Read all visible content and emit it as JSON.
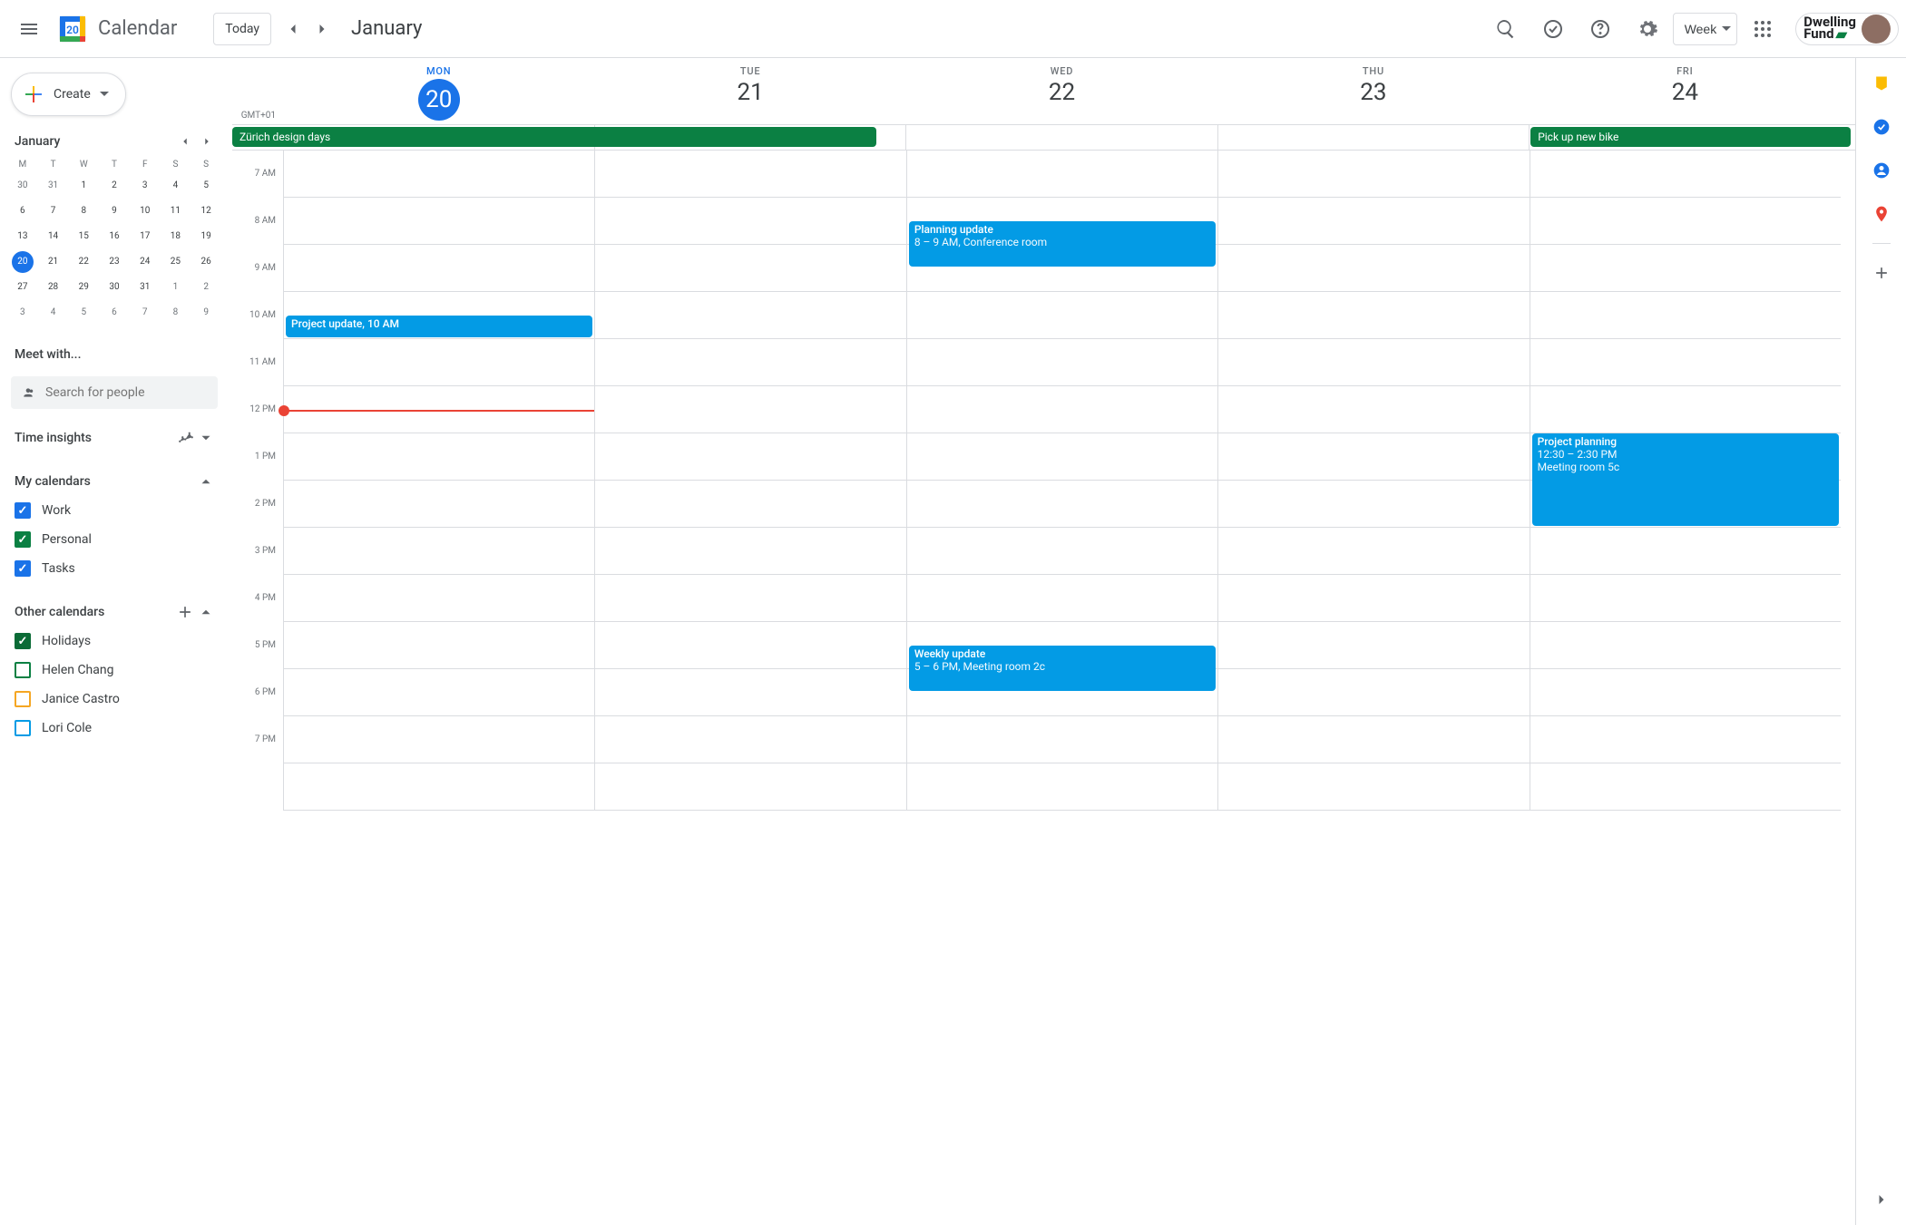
{
  "header": {
    "app_name": "Calendar",
    "today_btn": "Today",
    "period": "January",
    "view_label": "Week",
    "org_name_line1": "Dwelling",
    "org_name_line2": "Fund"
  },
  "sidebar": {
    "create_label": "Create",
    "mini_month": "January",
    "dow": [
      "M",
      "T",
      "W",
      "T",
      "F",
      "S",
      "S"
    ],
    "weeks": [
      [
        {
          "d": "30",
          "o": true
        },
        {
          "d": "31",
          "o": true
        },
        {
          "d": "1"
        },
        {
          "d": "2"
        },
        {
          "d": "3"
        },
        {
          "d": "4"
        },
        {
          "d": "5"
        }
      ],
      [
        {
          "d": "6"
        },
        {
          "d": "7"
        },
        {
          "d": "8"
        },
        {
          "d": "9"
        },
        {
          "d": "10"
        },
        {
          "d": "11"
        },
        {
          "d": "12"
        }
      ],
      [
        {
          "d": "13"
        },
        {
          "d": "14"
        },
        {
          "d": "15"
        },
        {
          "d": "16"
        },
        {
          "d": "17"
        },
        {
          "d": "18"
        },
        {
          "d": "19"
        }
      ],
      [
        {
          "d": "20",
          "t": true
        },
        {
          "d": "21"
        },
        {
          "d": "22"
        },
        {
          "d": "23"
        },
        {
          "d": "24"
        },
        {
          "d": "25"
        },
        {
          "d": "26"
        }
      ],
      [
        {
          "d": "27"
        },
        {
          "d": "28"
        },
        {
          "d": "29"
        },
        {
          "d": "30"
        },
        {
          "d": "31"
        },
        {
          "d": "1",
          "o": true
        },
        {
          "d": "2",
          "o": true
        }
      ],
      [
        {
          "d": "3",
          "o": true
        },
        {
          "d": "4",
          "o": true
        },
        {
          "d": "5",
          "o": true
        },
        {
          "d": "6",
          "o": true
        },
        {
          "d": "7",
          "o": true
        },
        {
          "d": "8",
          "o": true
        },
        {
          "d": "9",
          "o": true
        }
      ]
    ],
    "meet_with": "Meet with...",
    "search_placeholder": "Search for people",
    "time_insights": "Time insights",
    "my_calendars": "My calendars",
    "other_calendars": "Other calendars",
    "my_cals": [
      {
        "label": "Work",
        "color": "#1a73e8",
        "checked": true
      },
      {
        "label": "Personal",
        "color": "#0b8043",
        "checked": true
      },
      {
        "label": "Tasks",
        "color": "#1a73e8",
        "checked": true
      }
    ],
    "other_cals": [
      {
        "label": "Holidays",
        "color": "#0b6b36",
        "checked": true
      },
      {
        "label": "Helen Chang",
        "color": "#0b8043",
        "checked": false
      },
      {
        "label": "Janice Castro",
        "color": "#f5a623",
        "checked": false
      },
      {
        "label": "Lori Cole",
        "color": "#039be5",
        "checked": false
      }
    ]
  },
  "week": {
    "tz": "GMT+01",
    "days": [
      {
        "dow": "MON",
        "num": "20",
        "today": true
      },
      {
        "dow": "TUE",
        "num": "21"
      },
      {
        "dow": "WED",
        "num": "22"
      },
      {
        "dow": "THU",
        "num": "23"
      },
      {
        "dow": "FRI",
        "num": "24"
      }
    ],
    "hours": [
      "7 AM",
      "8 AM",
      "9 AM",
      "10 AM",
      "11 AM",
      "12 PM",
      "1 PM",
      "2 PM",
      "3 PM",
      "4 PM",
      "5 PM",
      "6 PM",
      "7 PM"
    ],
    "allday": [
      {
        "title": "Zürich design days",
        "startCol": 0,
        "span": 2,
        "color": "#0b8043"
      },
      {
        "title": "Pick up new bike",
        "startCol": 4,
        "span": 1,
        "color": "#0b8043"
      }
    ],
    "events": [
      {
        "col": 0,
        "title": "Project update, 10 AM",
        "sub": "",
        "startHour": 10,
        "durHours": 0.5,
        "color": "#039be5"
      },
      {
        "col": 2,
        "title": "Planning update",
        "sub": "8 – 9 AM, Conference room",
        "startHour": 8,
        "durHours": 1,
        "color": "#039be5"
      },
      {
        "col": 2,
        "title": "Weekly update",
        "sub": "5 – 6 PM, Meeting room 2c",
        "startHour": 17,
        "durHours": 1,
        "color": "#039be5"
      },
      {
        "col": 4,
        "title": "Project planning",
        "sub": "12:30 – 2:30 PM",
        "sub2": "Meeting room 5c",
        "startHour": 12.5,
        "durHours": 2,
        "color": "#039be5"
      }
    ],
    "nowHour": 12
  }
}
